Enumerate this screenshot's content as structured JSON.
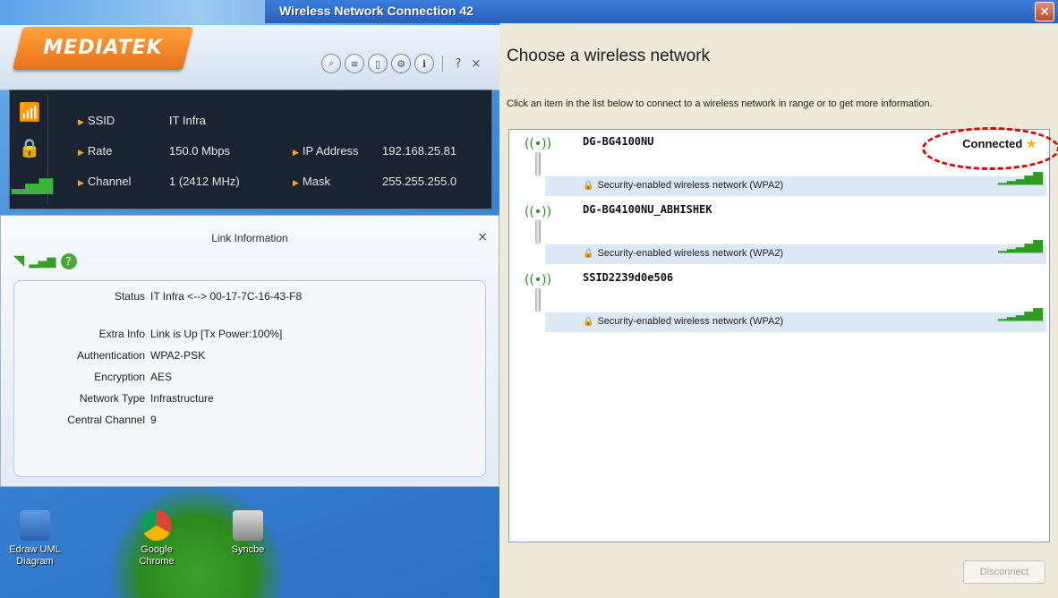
{
  "desktop": {
    "icons": [
      {
        "label": "Edraw UML Diagram",
        "left_text": "0.3"
      },
      {
        "label": "Google Chrome"
      },
      {
        "label": "Syncbe"
      }
    ]
  },
  "mediatek": {
    "logo": "MEDIATEK",
    "toolbar": {
      "help_label": "?",
      "close_label": "×"
    },
    "status": {
      "ssid_label": "SSID",
      "ssid_value": "IT Infra",
      "rate_label": "Rate",
      "rate_value": "150.0 Mbps",
      "channel_label": "Channel",
      "channel_value": "1 (2412 MHz)",
      "ip_label": "IP Address",
      "ip_value": "192.168.25.81",
      "mask_label": "Mask",
      "mask_value": "255.255.255.0"
    },
    "link_info": {
      "title": "Link Information",
      "close": "×",
      "rows": [
        {
          "key": "Status",
          "value": "IT Infra <--> 00-17-7C-16-43-F8"
        },
        {
          "key": "Extra Info",
          "value": "Link is Up  [Tx Power:100%]"
        },
        {
          "key": "Authentication",
          "value": "WPA2-PSK"
        },
        {
          "key": "Encryption",
          "value": "AES"
        },
        {
          "key": "Network Type",
          "value": "Infrastructure"
        },
        {
          "key": "Central Channel",
          "value": "9"
        }
      ]
    }
  },
  "wireless": {
    "title": "Wireless Network Connection 42",
    "close": "×",
    "heading": "Choose a wireless network",
    "description": "Click an item in the list below to connect to a wireless network in range or to get more information.",
    "networks": [
      {
        "name": "DG-BG4100NU",
        "security": "Security-enabled wireless network (WPA2)",
        "status": "Connected"
      },
      {
        "name": "DG-BG4100NU_ABHISHEK",
        "security": "Security-enabled wireless network (WPA2)",
        "status": ""
      },
      {
        "name": "SSID2239d0e506",
        "security": "Security-enabled wireless network (WPA2)",
        "status": ""
      }
    ],
    "disconnect_label": "Disconnect"
  }
}
